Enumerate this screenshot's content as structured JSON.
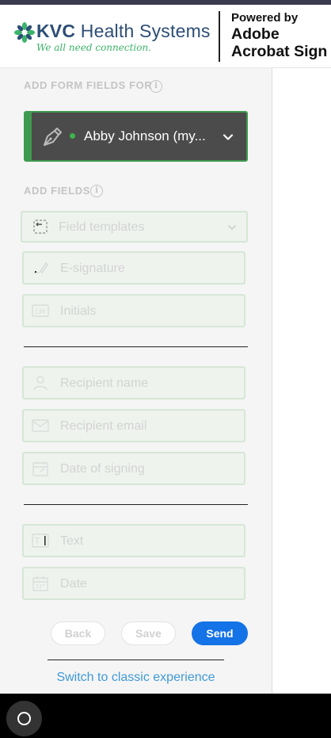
{
  "header": {
    "brand_initials": "KVC",
    "brand_name": "Health Systems",
    "brand_tagline": "We all need connection.",
    "powered_by": "Powered by",
    "powered_line2": "Adobe",
    "powered_line3": "Acrobat Sign"
  },
  "form_fields_section": {
    "title": "ADD FORM FIELDS FOR",
    "recipient_name": "Abby Johnson (my...",
    "status_color": "#3fb34f"
  },
  "add_fields_section": {
    "title": "ADD FIELDS",
    "fields": [
      {
        "label": "Field templates",
        "icon": "field-templates-icon"
      },
      {
        "label": "E-signature",
        "icon": "signature-pen-icon"
      },
      {
        "label": "Initials",
        "icon": "initials-icon"
      },
      {
        "label": "Recipient name",
        "icon": "person-icon"
      },
      {
        "label": "Recipient email",
        "icon": "envelope-icon"
      },
      {
        "label": "Date of signing",
        "icon": "calendar-sign-icon"
      },
      {
        "label": "Text",
        "icon": "text-field-icon"
      },
      {
        "label": "Date",
        "icon": "calendar-icon"
      }
    ]
  },
  "actions": {
    "back": "Back",
    "save": "Save",
    "send": "Send",
    "classic_link": "Switch to classic experience"
  },
  "colors": {
    "accent_green": "#3f9a4f",
    "primary_blue": "#1473e6",
    "link_blue": "#3f9ad6"
  }
}
